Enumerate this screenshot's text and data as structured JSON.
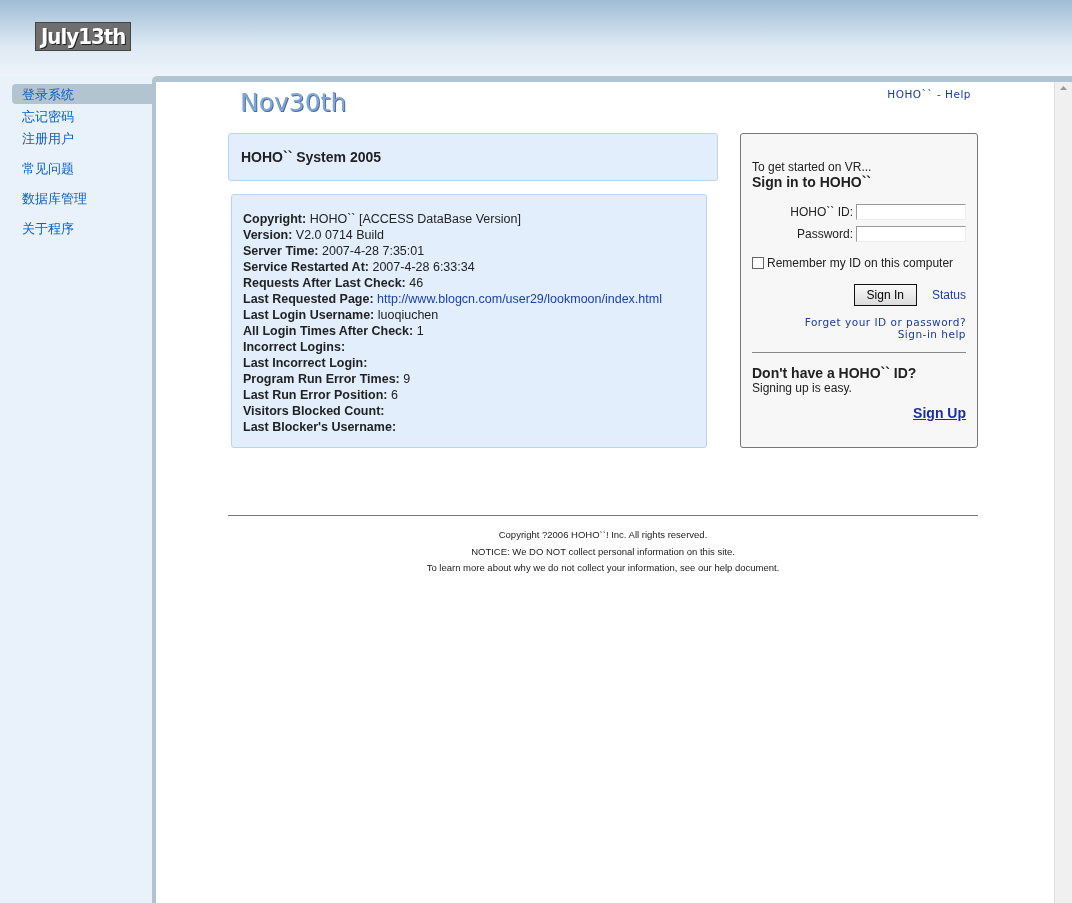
{
  "header": {
    "logo": "July13th"
  },
  "sidebar": {
    "items": [
      {
        "label": "登录系统",
        "selected": true
      },
      {
        "label": "忘记密码",
        "selected": false
      },
      {
        "label": "注册用户",
        "selected": false
      },
      {
        "label": "常见问题",
        "selected": false
      },
      {
        "label": "数据库管理",
        "selected": false
      },
      {
        "label": "关于程序",
        "selected": false
      }
    ]
  },
  "main": {
    "logo": "Nov30th",
    "help_link": "HOHO`` - Help",
    "system_title": "HOHO`` System 2005",
    "info": [
      {
        "label": "Copyright:",
        "value": "HOHO`` [ACCESS DataBase Version]",
        "kind": "text"
      },
      {
        "label": "Version:",
        "value": "V2.0 0714 Build",
        "kind": "text"
      },
      {
        "label": "Server Time:",
        "value": "2007-4-28 7:35:01",
        "kind": "text"
      },
      {
        "label": "Service Restarted At:",
        "value": "2007-4-28 6:33:34",
        "kind": "text"
      },
      {
        "label": "Requests After Last Check:",
        "value": "46",
        "kind": "text"
      },
      {
        "label": "Last Requested Page:",
        "value": "http://www.blogcn.com/user29/lookmoon/index.html",
        "kind": "link"
      },
      {
        "label": "Last Login Username:",
        "value": "luoqiuchen",
        "kind": "text"
      },
      {
        "label": "All Login Times After Check:",
        "value": "1",
        "kind": "text"
      },
      {
        "label": "Incorrect Logins:"
      },
      {
        "label": "Last Incorrect Login:"
      },
      {
        "label": "Program Run Error Times:",
        "value": "9",
        "kind": "text"
      },
      {
        "label": "Last Run Error Position:",
        "value": "6",
        "kind": "text"
      },
      {
        "label": "Visitors Blocked Count:"
      },
      {
        "label": "Last Blocker's Username:"
      }
    ]
  },
  "signin": {
    "intro": "To get started on VR...",
    "title": "Sign in to HOHO``",
    "id_label": "HOHO`` ID:",
    "password_label": "Password:",
    "remember": {
      "label": "Remember my ID on this computer",
      "checked": false
    },
    "button": "Sign In",
    "status_link": "Status",
    "forgot_link": "Forget your ID or password?",
    "help_link": "Sign-in help",
    "signup_title": "Don't have a HOHO`` ID?",
    "signup_text": "Signing up is easy.",
    "signup_link": "Sign Up"
  },
  "footer": [
    "Copyright ?2006 HOHO``! Inc. All rights reserved.",
    "NOTICE: We DO NOT collect personal information on this site.",
    "To learn more about why we do not collect your information, see our help document."
  ]
}
